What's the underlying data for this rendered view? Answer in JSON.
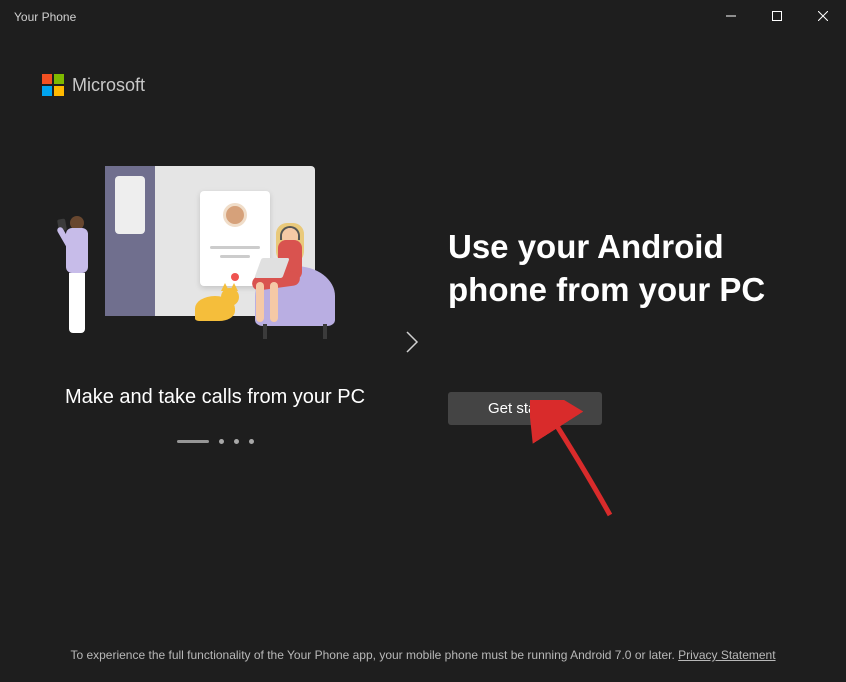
{
  "window": {
    "title": "Your Phone"
  },
  "brand": "Microsoft",
  "carousel": {
    "caption": "Make and take calls from your PC"
  },
  "headline": "Use your Android phone from your PC",
  "cta": "Get started",
  "footer": {
    "text": "To experience the full functionality of the Your Phone app, your mobile phone must be running Android 7.0 or later. ",
    "link": "Privacy Statement"
  }
}
